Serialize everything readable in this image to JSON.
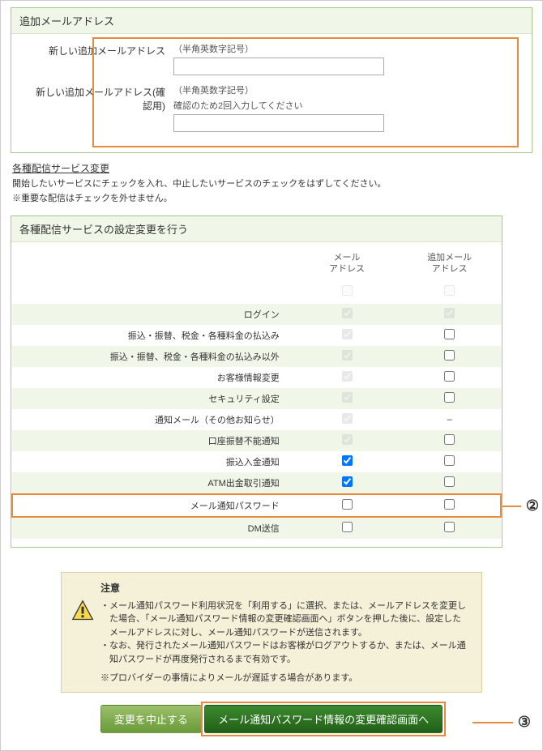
{
  "section1": {
    "title": "追加メールアドレス",
    "row1_label": "新しい追加メールアドレス",
    "row1_hint": "（半角英数字記号）",
    "row2_label": "新しい追加メールアドレス(確認用)",
    "row2_hint1": "（半角英数字記号）",
    "row2_hint2": "確認のため2回入力してください"
  },
  "section2": {
    "heading": "各種配信サービス変更",
    "desc": "開始したいサービスにチェックを入れ、中止したいサービスのチェックをはずしてください。",
    "note": "※重要な配信はチェックを外せません。",
    "title": "各種配信サービスの設定変更を行う",
    "col1": "メール\nアドレス",
    "col2": "追加メール\nアドレス",
    "rows": [
      {
        "label": "ログイン",
        "c1": "cd",
        "c2": "cd"
      },
      {
        "label": "振込・振替、税金・各種料金の払込み",
        "c1": "cd",
        "c2": "u"
      },
      {
        "label": "振込・振替、税金・各種料金の払込み以外",
        "c1": "cd",
        "c2": "u"
      },
      {
        "label": "お客様情報変更",
        "c1": "cd",
        "c2": "u"
      },
      {
        "label": "セキュリティ設定",
        "c1": "cd",
        "c2": "u"
      },
      {
        "label": "通知メール（その他お知らせ）",
        "c1": "cd",
        "c2": "dash"
      },
      {
        "label": "口座振替不能通知",
        "c1": "cd",
        "c2": "u"
      },
      {
        "label": "振込入金通知",
        "c1": "c",
        "c2": "u"
      },
      {
        "label": "ATM出金取引通知",
        "c1": "c",
        "c2": "u"
      },
      {
        "label": "メール通知パスワード",
        "c1": "u",
        "c2": "u",
        "hl": true
      },
      {
        "label": "DM送信",
        "c1": "u",
        "c2": "u"
      }
    ]
  },
  "notice": {
    "title": "注意",
    "items": [
      "メール通知パスワード利用状況を「利用する」に選択、または、メールアドレスを変更した場合、「メール通知パスワード情報の変更確認画面へ」ボタンを押した後に、設定したメールアドレスに対し、メール通知パスワードが送信されます。",
      "なお、発行されたメール通知パスワードはお客様がログアウトするか、または、メール通知パスワードが再度発行されるまで有効です。"
    ],
    "extra": "※プロバイダーの事情によりメールが遅延する場合があります。"
  },
  "buttons": {
    "cancel": "変更を中止する",
    "primary": "メール通知パスワード情報の変更確認画面へ"
  },
  "callouts": {
    "two": "②",
    "three": "③"
  }
}
